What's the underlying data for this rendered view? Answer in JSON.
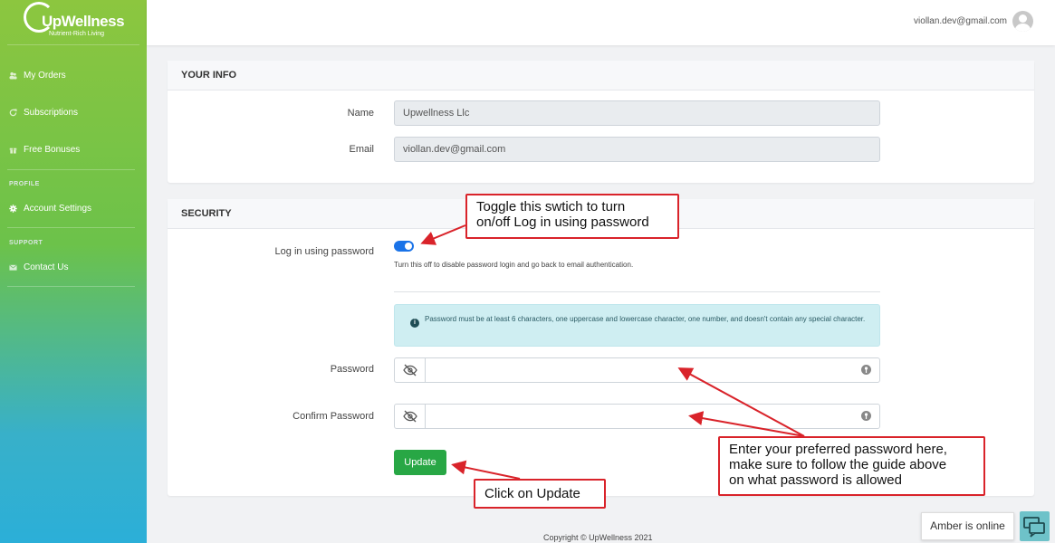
{
  "brand": {
    "name": "UpWellness",
    "tagline": "Nutrient-Rich Living"
  },
  "sidebar": {
    "items": [
      {
        "label": "My Orders",
        "icon": "users-icon"
      },
      {
        "label": "Subscriptions",
        "icon": "refresh-icon"
      },
      {
        "label": "Free Bonuses",
        "icon": "gift-icon"
      }
    ],
    "profile_label": "PROFILE",
    "profile_item": {
      "label": "Account Settings",
      "icon": "gear-icon"
    },
    "support_label": "SUPPORT",
    "support_item": {
      "label": "Contact Us",
      "icon": "envelope-icon"
    }
  },
  "header": {
    "user_email": "viollan.dev@gmail.com"
  },
  "your_info": {
    "title": "YOUR INFO",
    "name_label": "Name",
    "name_value": "Upwellness Llc",
    "email_label": "Email",
    "email_value": "viollan.dev@gmail.com"
  },
  "security": {
    "title": "SECURITY",
    "login_label": "Log in using password",
    "toggle_on": true,
    "help_text": "Turn this off to disable password login and go back to email authentication.",
    "alert_text": "Password must be at least 6 characters, one uppercase and lowercase character, one number, and doesn't contain any special character.",
    "password_label": "Password",
    "confirm_label": "Confirm Password",
    "update_label": "Update"
  },
  "footer": {
    "copyright": "Copyright © UpWellness 2021"
  },
  "annotations": {
    "toggle_note": "Toggle this swtich to turn\non/off Log in using password",
    "password_note": "Enter your preferred password here,\nmake sure to follow the guide above\non what password is allowed",
    "update_note": "Click on Update"
  },
  "chat": {
    "status": "Amber is online"
  },
  "colors": {
    "accent": "#1a73e8",
    "update_button": "#28a745",
    "callout_border": "#d9232a"
  }
}
